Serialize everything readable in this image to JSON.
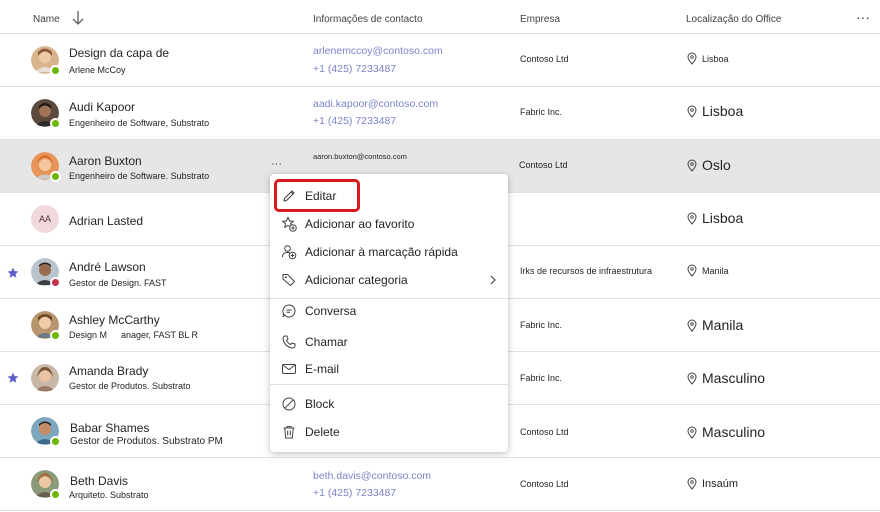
{
  "header": {
    "name": "Name",
    "contact": "Informações de contacto",
    "company": "Empresa",
    "location": "Localização do Office",
    "more": "···"
  },
  "rows": [
    {
      "name": "Design da capa de",
      "title": "Arlene McCoy",
      "email": "arlenemccoy@contoso.com",
      "phone": "+1 (425) 7233487",
      "company": "Contoso Ltd",
      "location": "Lisboa"
    },
    {
      "name": "Audi Kapoor",
      "title": "Engenheiro de Software, Substrato",
      "email": "aadi.kapoor@contoso.com",
      "phone": "+1 (425) 7233487",
      "company": "Fabric Inc.",
      "location": "Lisboa"
    },
    {
      "name": "Aaron Buxton",
      "title": "Engenheiro de Software. Substrato",
      "email": "aaron.buxton@contoso.com",
      "phone": "",
      "company": "Contoso Ltd",
      "location": "Oslo",
      "more": "···"
    },
    {
      "name": "Adrian Lasted",
      "initials": "AA",
      "title": "",
      "email": "",
      "phone": "",
      "company": "",
      "location": "Lisboa"
    },
    {
      "name": "André Lawson",
      "title": "Gestor de Design. FAST",
      "email": "",
      "phone": "",
      "company": "Irks de recursos de infraestrutura",
      "location": "Manila"
    },
    {
      "name": "Ashley McCarthy",
      "title": "Design M",
      "title2": "anager, FAST BL R",
      "email": "",
      "phone": "",
      "company": "Fabric Inc.",
      "location": "Manila"
    },
    {
      "name": "Amanda Brady",
      "title": "Gestor de Produtos. Substrato",
      "email": "",
      "phone": "",
      "company": "Fabric Inc.",
      "location": "Masculino"
    },
    {
      "name": "Babar Shames",
      "title": "Gestor de Produtos. Substrato PM",
      "email": "",
      "phone": "",
      "company": "Contoso Ltd",
      "location": "Masculino"
    },
    {
      "name": "Beth Davis",
      "title": "Arquiteto. Substrato",
      "email": "beth.davis@contoso.com",
      "phone": "+1 (425) 7233487",
      "company": "Contoso Ltd",
      "location": "Insaúm"
    }
  ],
  "menu": {
    "edit": "Editar",
    "favorite": "Adicionar ao favorito",
    "quick_mark": "Adicionar à marcação rápida",
    "category": "Adicionar categoria",
    "chat": "Conversa",
    "call": "Chamar",
    "email": "E-mail",
    "block": "Block",
    "delete": "Delete"
  },
  "colors": {
    "accent": "#5b5fc7",
    "link": "#7b83c9",
    "available": "#6bb700",
    "busy": "#c4314b",
    "highlight": "#d71920",
    "selected_row": "#e6e6e6"
  }
}
